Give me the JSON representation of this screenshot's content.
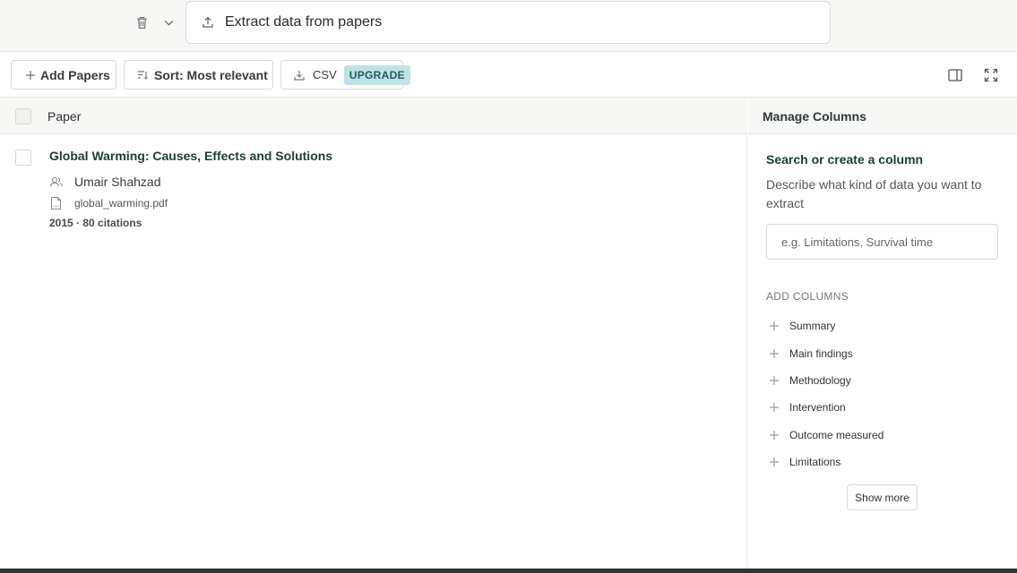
{
  "header": {
    "extract_label": "Extract data from papers"
  },
  "toolbar": {
    "add_papers": "Add Papers",
    "sort_label": "Sort: Most relevant",
    "csv_label": "CSV",
    "upgrade_badge": "UPGRADE"
  },
  "table": {
    "column_paper": "Paper",
    "rows": [
      {
        "title": "Global Warming: Causes, Effects and Solutions",
        "author": "Umair Shahzad",
        "file": "global_warming.pdf",
        "meta": "2015 · 80 citations"
      }
    ]
  },
  "manage": {
    "title": "Manage Columns",
    "search_heading": "Search or create a column",
    "search_desc": "Describe what kind of data you want to extract",
    "search_placeholder": "e.g. Limitations, Survival time",
    "add_columns_label": "ADD COLUMNS",
    "columns": [
      "Summary",
      "Main findings",
      "Methodology",
      "Intervention",
      "Outcome measured",
      "Limitations"
    ],
    "show_more": "Show more"
  },
  "icons": [
    "trash-icon",
    "chevron-down-icon",
    "upload-icon",
    "plus-icon",
    "sort-icon",
    "download-icon",
    "sidebar-toggle-icon",
    "expand-icon",
    "authors-icon",
    "pdf-file-icon"
  ]
}
